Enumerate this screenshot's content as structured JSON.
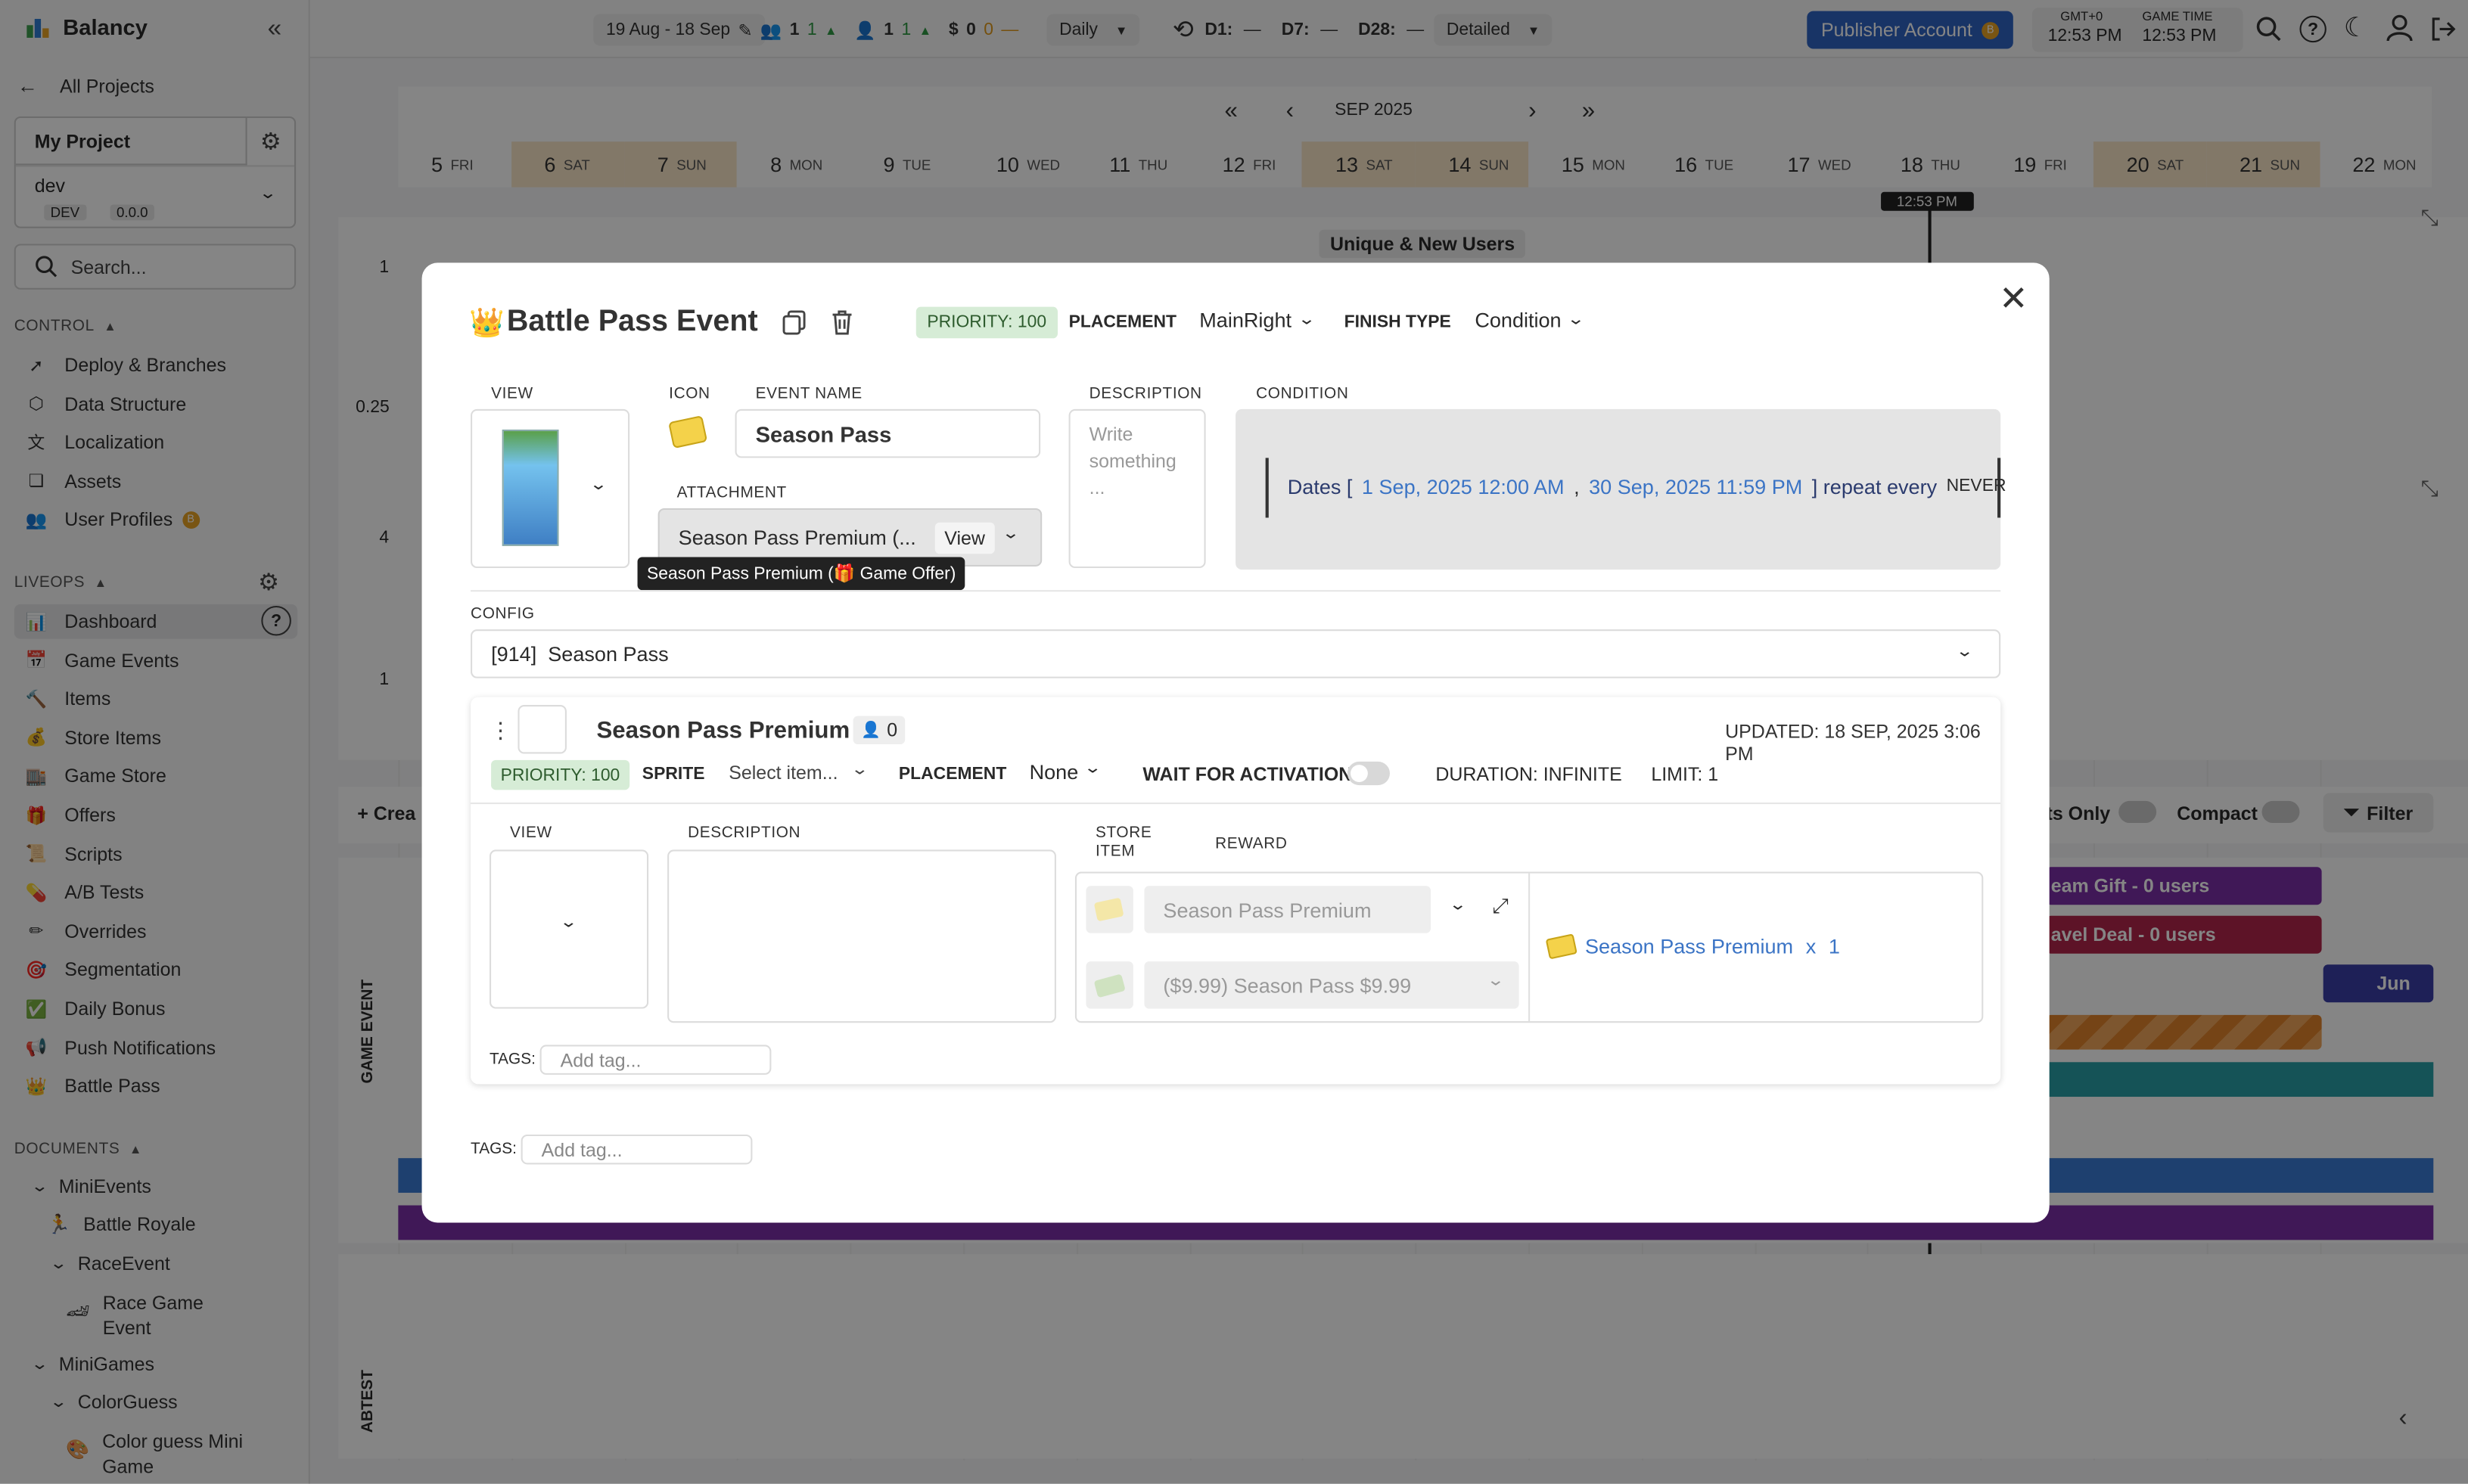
{
  "app": {
    "name": "Balancy",
    "back_label": "All Projects",
    "project": {
      "name": "My Project",
      "branch": "dev",
      "env_badge": "DEV",
      "version_badge": "0.0.0"
    },
    "search_placeholder": "Search..."
  },
  "sidebar": {
    "control_label": "CONTROL",
    "control_items": [
      {
        "label": "Deploy & Branches",
        "icon": "rocket-icon"
      },
      {
        "label": "Data Structure",
        "icon": "cube-icon"
      },
      {
        "label": "Localization",
        "icon": "translate-icon"
      },
      {
        "label": "Assets",
        "icon": "layers-icon"
      },
      {
        "label": "User Profiles",
        "icon": "users-icon",
        "badge": "B"
      }
    ],
    "liveops_label": "LIVEOPS",
    "liveops_items": [
      {
        "label": "Dashboard",
        "icon": "bar-chart-icon",
        "active": true
      },
      {
        "label": "Game Events",
        "icon": "calendar-icon"
      },
      {
        "label": "Items",
        "icon": "hammer-icon"
      },
      {
        "label": "Store Items",
        "icon": "money-bag-icon"
      },
      {
        "label": "Game Store",
        "icon": "store-icon"
      },
      {
        "label": "Offers",
        "icon": "gift-icon"
      },
      {
        "label": "Scripts",
        "icon": "scroll-icon"
      },
      {
        "label": "A/B Tests",
        "icon": "pill-icon"
      },
      {
        "label": "Overrides",
        "icon": "pencil-icon"
      },
      {
        "label": "Segmentation",
        "icon": "target-icon"
      },
      {
        "label": "Daily Bonus",
        "icon": "checkbox-icon"
      },
      {
        "label": "Push Notifications",
        "icon": "megaphone-icon"
      },
      {
        "label": "Battle Pass",
        "icon": "crown-icon"
      }
    ],
    "documents_label": "DOCUMENTS",
    "documents_tree": {
      "mini_events": "MiniEvents",
      "battle_royale": "Battle Royale",
      "race_event": "RaceEvent",
      "race_game_event": "Race Game Event",
      "mini_games": "MiniGames",
      "color_guess": "ColorGuess",
      "color_guess_mini_game": "Color guess Mini Game"
    }
  },
  "topbar": {
    "date_range": "19 Aug - 18 Sep",
    "stat_users_a": "1",
    "stat_users_a_delta": "1",
    "stat_users_b": "1",
    "stat_users_b_delta": "1",
    "stat_revenue": "0",
    "stat_revenue_delta": "0",
    "stat_revenue_dash": "—",
    "granularity": "Daily",
    "retention_d1": "D1:",
    "retention_d1_val": "—",
    "retention_d7": "D7:",
    "retention_d7_val": "—",
    "retention_d28": "D28:",
    "retention_d28_val": "—",
    "detail_mode": "Detailed",
    "publisher_button": "Publisher Account",
    "publisher_badge": "B",
    "tz_label": "GMT+0",
    "tz_time": "12:53 PM",
    "game_time_label": "GAME TIME",
    "game_time": "12:53 PM"
  },
  "calendar": {
    "month": "SEP 2025",
    "days": [
      {
        "num": "5",
        "dow": "FRI",
        "weekend": false
      },
      {
        "num": "6",
        "dow": "SAT",
        "weekend": true
      },
      {
        "num": "7",
        "dow": "SUN",
        "weekend": true
      },
      {
        "num": "8",
        "dow": "MON",
        "weekend": false
      },
      {
        "num": "9",
        "dow": "TUE",
        "weekend": false
      },
      {
        "num": "10",
        "dow": "WED",
        "weekend": false
      },
      {
        "num": "11",
        "dow": "THU",
        "weekend": false
      },
      {
        "num": "12",
        "dow": "FRI",
        "weekend": false
      },
      {
        "num": "13",
        "dow": "SAT",
        "weekend": true
      },
      {
        "num": "14",
        "dow": "SUN",
        "weekend": true
      },
      {
        "num": "15",
        "dow": "MON",
        "weekend": false
      },
      {
        "num": "16",
        "dow": "TUE",
        "weekend": false
      },
      {
        "num": "17",
        "dow": "WED",
        "weekend": false
      },
      {
        "num": "18",
        "dow": "THU",
        "weekend": false
      },
      {
        "num": "19",
        "dow": "FRI",
        "weekend": false
      },
      {
        "num": "20",
        "dow": "SAT",
        "weekend": true
      },
      {
        "num": "21",
        "dow": "SUN",
        "weekend": true
      },
      {
        "num": "22",
        "dow": "MON",
        "weekend": false
      }
    ],
    "now_marker": "12:53 PM",
    "chart_title": "Unique & New Users",
    "y_ticks": [
      "1",
      "0.25",
      "4",
      "1"
    ],
    "create_button": "+ Crea",
    "events_only_label": "ts Only",
    "compact_label": "Compact",
    "filter_button": "Filter",
    "game_event_label": "GAME EVENT",
    "abtest_label": "ABTEST",
    "bars": [
      "eam Gift - 0 users",
      "avel Deal - 0 users",
      "Jun"
    ]
  },
  "modal": {
    "title": "Battle Pass Event",
    "priority_badge": "PRIORITY: 100",
    "placement_label": "PLACEMENT",
    "placement_value": "MainRight",
    "finish_type_label": "FINISH TYPE",
    "finish_type_value": "Condition",
    "view_label": "VIEW",
    "icon_label": "ICON",
    "event_name_label": "EVENT NAME",
    "event_name_value": "Season Pass",
    "description_label": "DESCRIPTION",
    "description_placeholder": "Write something ...",
    "condition_label": "CONDITION",
    "condition": {
      "dates_label": "Dates [",
      "start": "1 Sep, 2025 12:00 AM",
      "sep": ",",
      "end": "30 Sep, 2025 11:59 PM",
      "repeat_label": "] repeat every",
      "repeat_value": "NEVER"
    },
    "attachment_label": "ATTACHMENT",
    "attachment_value": "Season Pass Premium (...",
    "attachment_view_button": "View",
    "attachment_tooltip": "Season Pass Premium (🎁 Game Offer)",
    "config_label": "CONFIG",
    "config_value": "[914]  Season Pass",
    "offer": {
      "name": "Season Pass Premium",
      "users_count": "0",
      "updated": "UPDATED: 18 SEP, 2025 3:06 PM",
      "priority_badge": "PRIORITY: 100",
      "sprite_label": "SPRITE",
      "sprite_placeholder": "Select item...",
      "placement_label": "PLACEMENT",
      "placement_value": "None",
      "wait_label": "WAIT FOR ACTIVATION:",
      "wait_enabled": false,
      "duration": "DURATION: INFINITE",
      "limit": "LIMIT: 1",
      "view_label": "VIEW",
      "description_label": "DESCRIPTION",
      "store_item_label_1": "STORE",
      "store_item_label_2": "ITEM",
      "reward_label": "REWARD",
      "store_item_value": "Season Pass Premium",
      "price_value": "($9.99) Season Pass $9.99",
      "reward_value": "Season Pass Premium",
      "reward_mult": "x",
      "reward_qty": "1",
      "tags_label": "TAGS:",
      "tags_placeholder": "Add tag..."
    },
    "tags_label": "TAGS:",
    "tags_placeholder": "Add tag..."
  },
  "colors": {
    "accent": "#2f64c4",
    "priority_bg": "#d6ecd6",
    "priority_fg": "#2e6b2e",
    "weekend": "#fae6c8",
    "link": "#3b74c5",
    "bar_purple": "#7b2fa8",
    "bar_red": "#b3264b",
    "bar_orange": "#e0822b",
    "bar_teal": "#2aa0a8",
    "bar_blue": "#3a7bd5"
  }
}
